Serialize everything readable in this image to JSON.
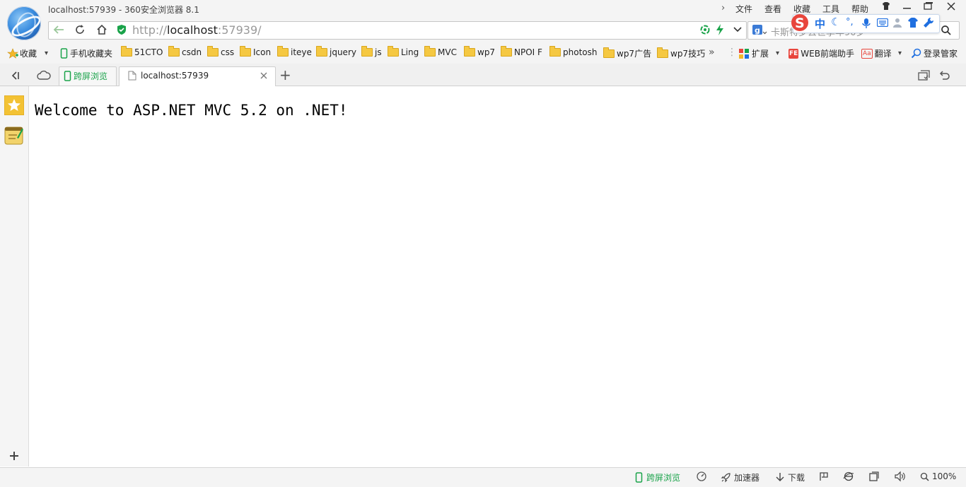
{
  "window": {
    "title": "localhost:57939 - 360安全浏览器 8.1",
    "menu": [
      "文件",
      "查看",
      "收藏",
      "工具",
      "帮助"
    ]
  },
  "address": {
    "scheme": "http://",
    "host": "localhost",
    "rest": ":57939/"
  },
  "search": {
    "placeholder": "卡斯特罗去世享年90岁"
  },
  "bookmarks": {
    "favorites_label": "收藏",
    "mobile_label": "手机收藏夹",
    "folders": [
      "51CTO",
      "csdn",
      "css",
      "Icon",
      "iteye",
      "jquery",
      "js",
      "Ling",
      "MVC",
      "wp7",
      "NPOI F",
      "photosh",
      "wp7广告",
      "wp7技巧"
    ],
    "extensions_label": "扩展",
    "web_helper_label": "WEB前端助手",
    "web_helper_badge": "FE",
    "translate_label": "翻译",
    "translate_badge": "Aa",
    "login_label": "登录管家"
  },
  "tabs": {
    "cross_screen_label": "跨屏浏览",
    "active_label": "localhost:57939",
    "new_tab_symbol": "+"
  },
  "content": {
    "text": "Welcome to ASP.NET MVC 5.2 on .NET!"
  },
  "ime": {
    "lang": "中"
  },
  "status": {
    "cross_screen_label": "跨屏浏览",
    "accelerator_label": "加速器",
    "download_label": "下载",
    "zoom_label": "100%"
  },
  "colors": {
    "accent_green": "#1aa34a",
    "link_blue": "#1f6fe0",
    "chrome_gray": "#f4f4f4"
  }
}
